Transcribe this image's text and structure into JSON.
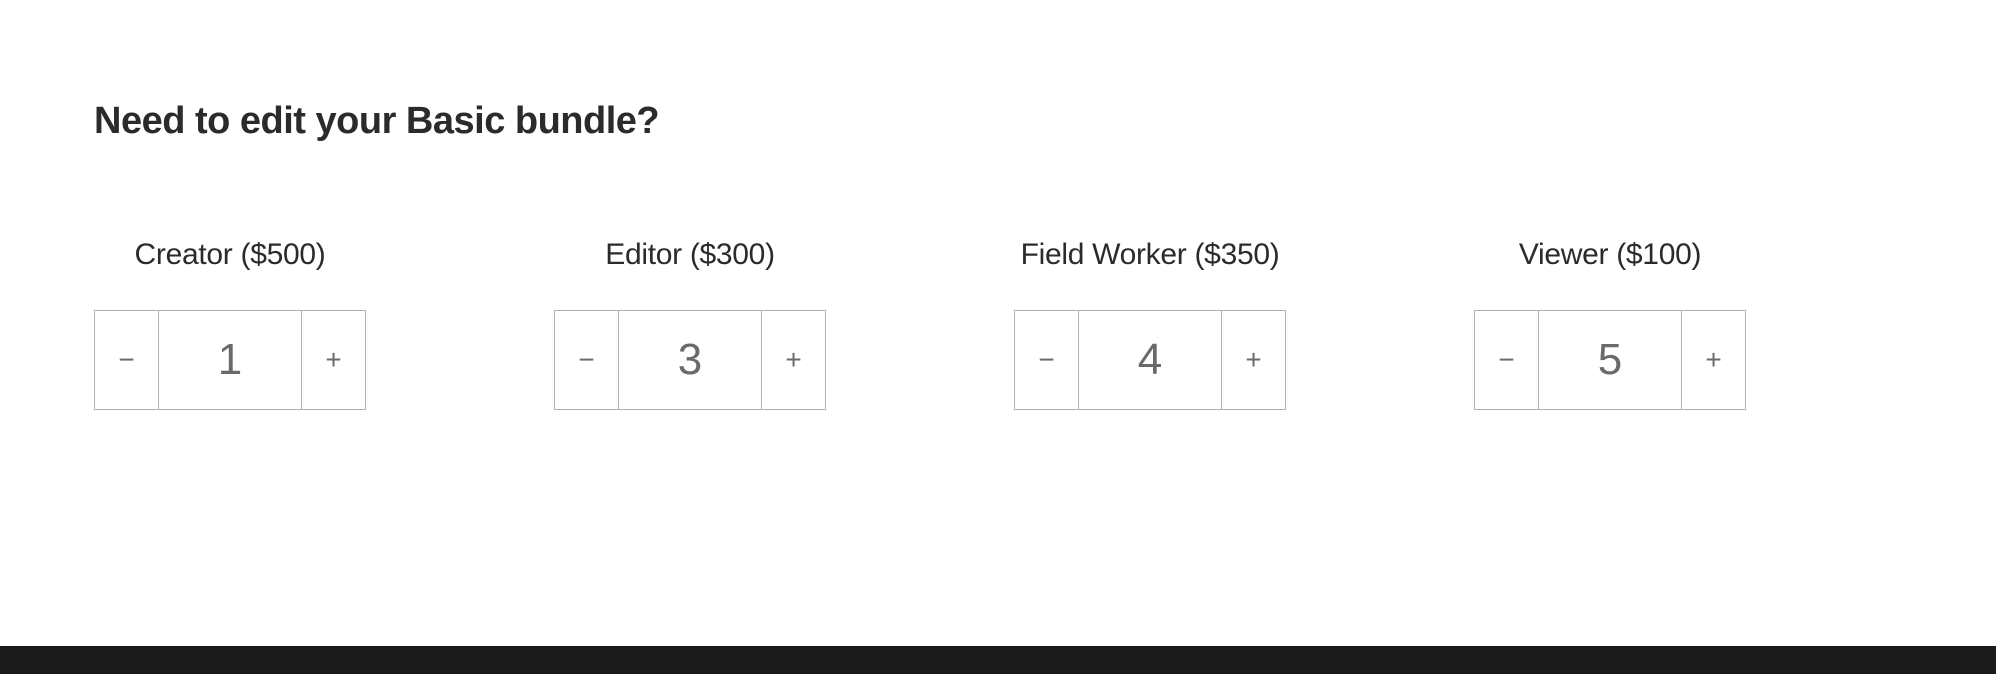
{
  "page": {
    "title": "Need to edit your Basic bundle?"
  },
  "steppers": [
    {
      "id": "creator",
      "label": "Creator ($500)",
      "value": "1",
      "minus": "−",
      "plus": "+"
    },
    {
      "id": "editor",
      "label": "Editor ($300)",
      "value": "3",
      "minus": "−",
      "plus": "+"
    },
    {
      "id": "field-worker",
      "label": "Field Worker ($350)",
      "value": "4",
      "minus": "−",
      "plus": "+"
    },
    {
      "id": "viewer",
      "label": "Viewer ($100)",
      "value": "5",
      "minus": "−",
      "plus": "+"
    }
  ]
}
